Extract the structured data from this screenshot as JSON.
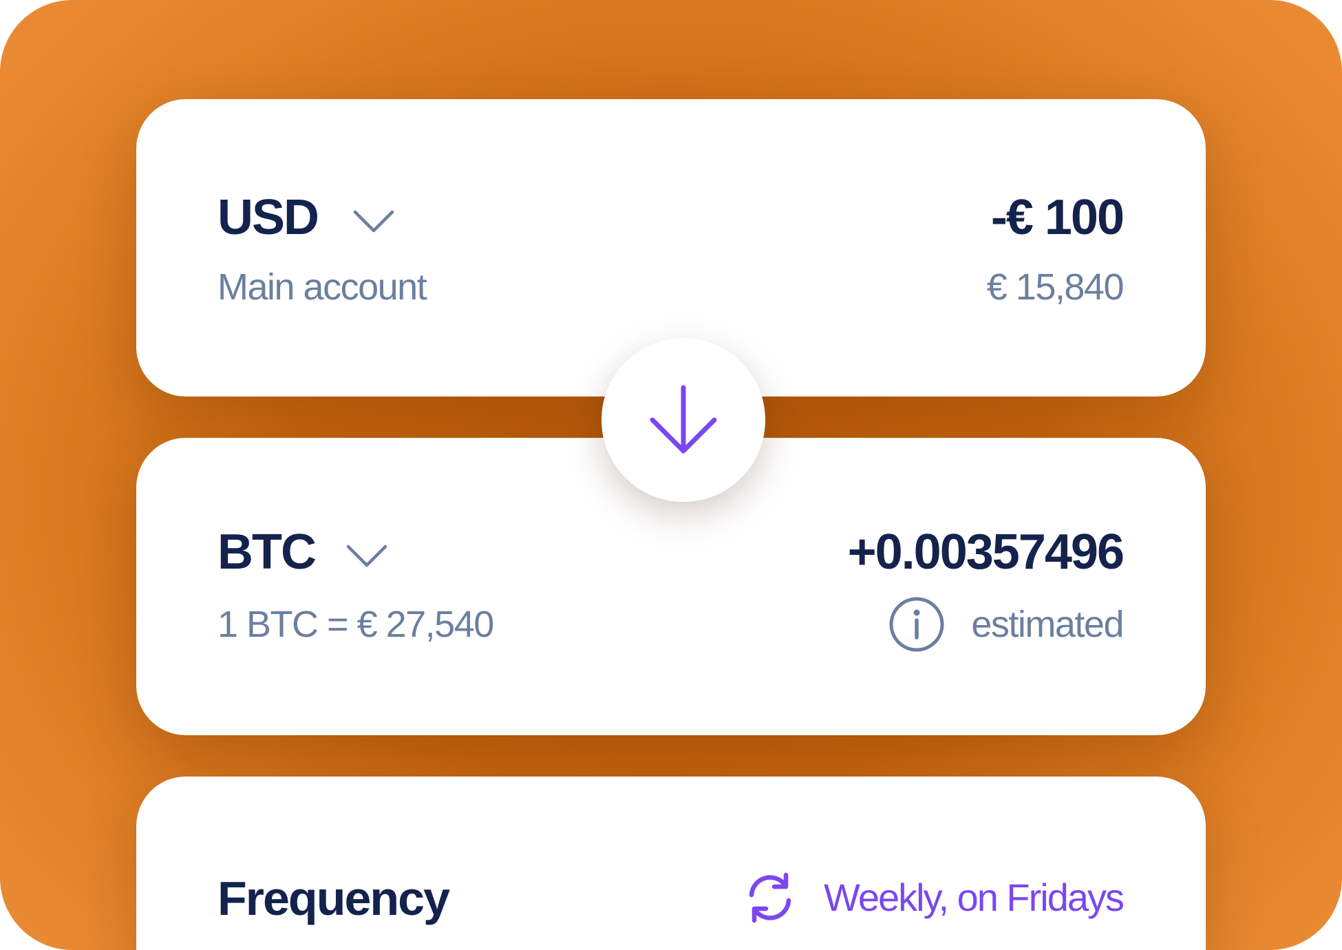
{
  "from": {
    "currency": "USD",
    "account_label": "Main account",
    "amount": "-€ 100",
    "balance": "€ 15,840",
    "chevron_icon": "chevron-down-icon"
  },
  "swap": {
    "icon": "arrow-down-icon",
    "accent_color": "#7b47f0"
  },
  "to": {
    "currency": "BTC",
    "rate": "1 BTC = € 27,540",
    "amount": "+0.00357496",
    "estimate_label": "estimated",
    "info_icon": "info-icon",
    "chevron_icon": "chevron-down-icon"
  },
  "frequency": {
    "title": "Frequency",
    "value": "Weekly, on Fridays",
    "icon": "refresh-icon"
  },
  "colors": {
    "background": "#d9761d",
    "title_text": "#13234d",
    "secondary_text": "#6b7f9f",
    "accent": "#7b47f0"
  }
}
